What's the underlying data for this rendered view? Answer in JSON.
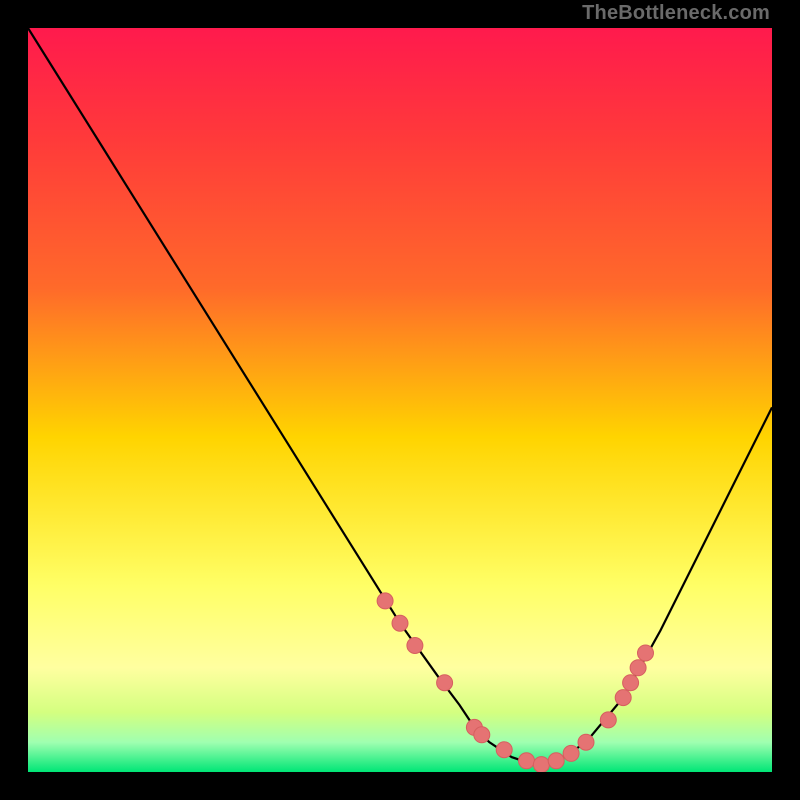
{
  "watermark": "TheBottleneck.com",
  "colors": {
    "frame": "#000000",
    "gradient_top": "#ff1a4d",
    "gradient_mid1": "#ff6a2a",
    "gradient_mid2": "#ffd400",
    "gradient_mid3": "#ffff66",
    "gradient_mid4": "#d4ff80",
    "gradient_bottom": "#00e676",
    "curve": "#000000",
    "marker_fill": "#e57373",
    "marker_stroke": "#d65f5f"
  },
  "chart_data": {
    "type": "line",
    "title": "",
    "xlabel": "",
    "ylabel": "",
    "xlim": [
      0,
      100
    ],
    "ylim": [
      0,
      100
    ],
    "grid": false,
    "legend": false,
    "series": [
      {
        "name": "bottleneck-curve",
        "x": [
          0,
          5,
          10,
          15,
          20,
          25,
          30,
          35,
          40,
          45,
          50,
          55,
          58,
          60,
          62,
          65,
          68,
          70,
          72,
          75,
          80,
          85,
          90,
          95,
          100
        ],
        "y": [
          100,
          92,
          84,
          76,
          68,
          60,
          52,
          44,
          36,
          28,
          20,
          13,
          9,
          6,
          4,
          2,
          1,
          1,
          2,
          4,
          10,
          19,
          29,
          39,
          49
        ]
      }
    ],
    "markers": {
      "name": "highlight-dots",
      "x": [
        48,
        50,
        52,
        56,
        60,
        61,
        64,
        67,
        69,
        71,
        73,
        75,
        78,
        80,
        81,
        82,
        83
      ],
      "y": [
        23,
        20,
        17,
        12,
        6,
        5,
        3,
        1.5,
        1,
        1.5,
        2.5,
        4,
        7,
        10,
        12,
        14,
        16
      ]
    },
    "background": "vertical-heatmap-gradient"
  }
}
